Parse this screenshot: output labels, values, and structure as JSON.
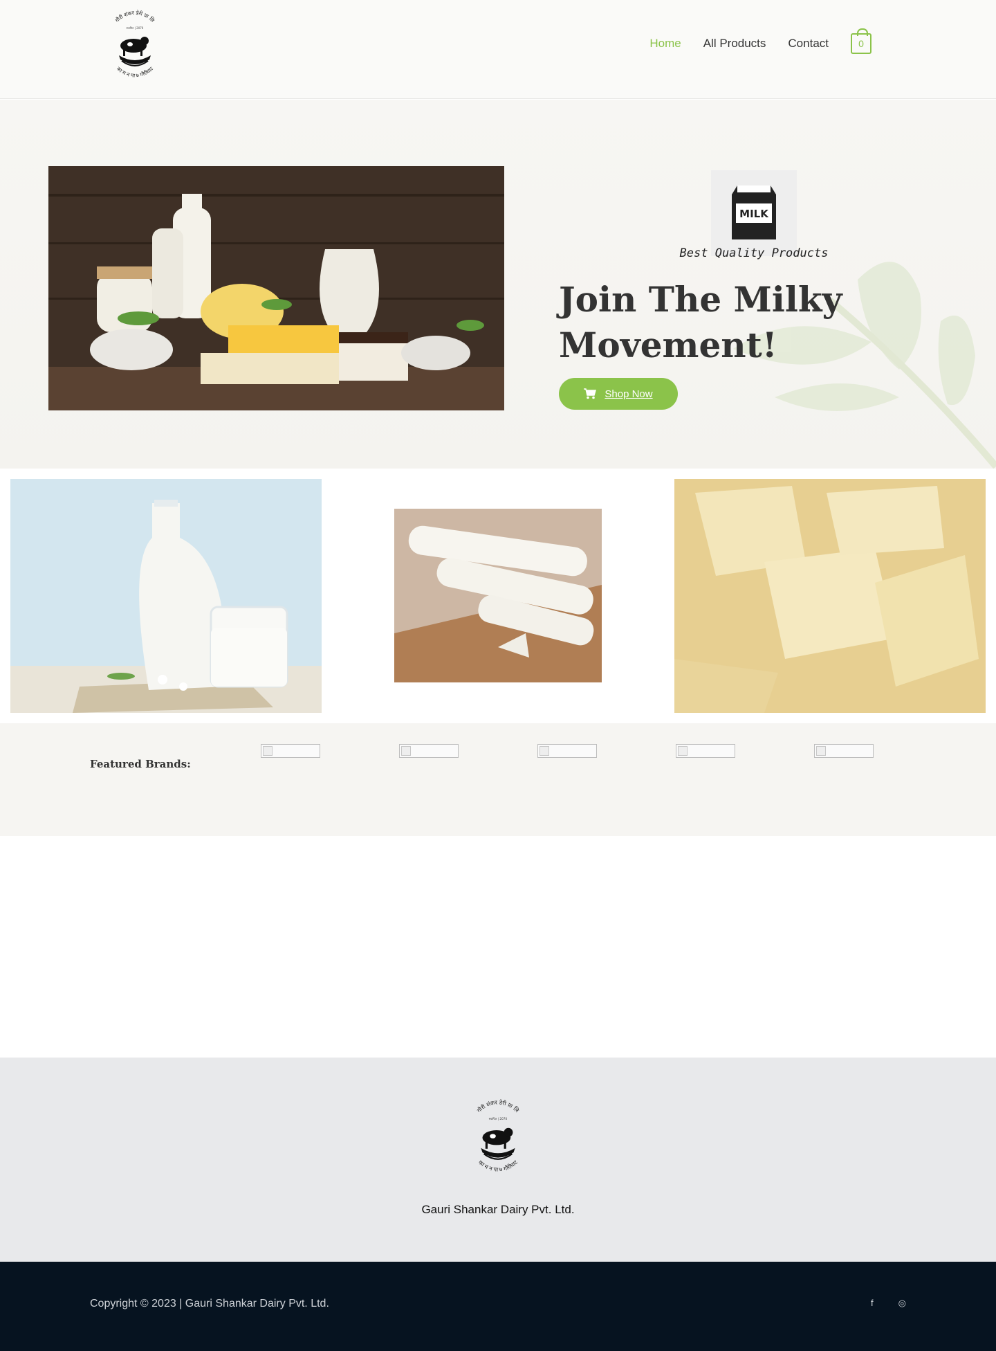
{
  "header": {
    "logo_name": "gauri-shankar-dairy-logo",
    "logo_text_top": "गौरी शंकर डेरी प्रा लि",
    "logo_text_mid": "स्थापित | 2070",
    "logo_text_bottom": "का म न पा ७ गौरीघाट",
    "nav": [
      {
        "label": "Home",
        "active": true
      },
      {
        "label": "All Products",
        "active": false
      },
      {
        "label": "Contact",
        "active": false
      }
    ],
    "cart_count": "0"
  },
  "hero": {
    "icon_text": "MILK",
    "tagline": "Best Quality Products",
    "title": "Join The Milky Movement!",
    "cta_label": "Shop Now",
    "accent": "#8bc34a"
  },
  "brands": {
    "label": "Featured Brands:"
  },
  "footer": {
    "company_name": "Gauri Shankar Dairy Pvt. Ltd.",
    "copyright": "Copyright © 2023 | Gauri Shankar Dairy Pvt. Ltd.",
    "social": [
      "facebook-icon",
      "dribbble-icon"
    ]
  },
  "colors": {
    "accent": "#8bc34a",
    "bottom_bar": "#061320",
    "footer_bg": "#e8e9eb"
  }
}
